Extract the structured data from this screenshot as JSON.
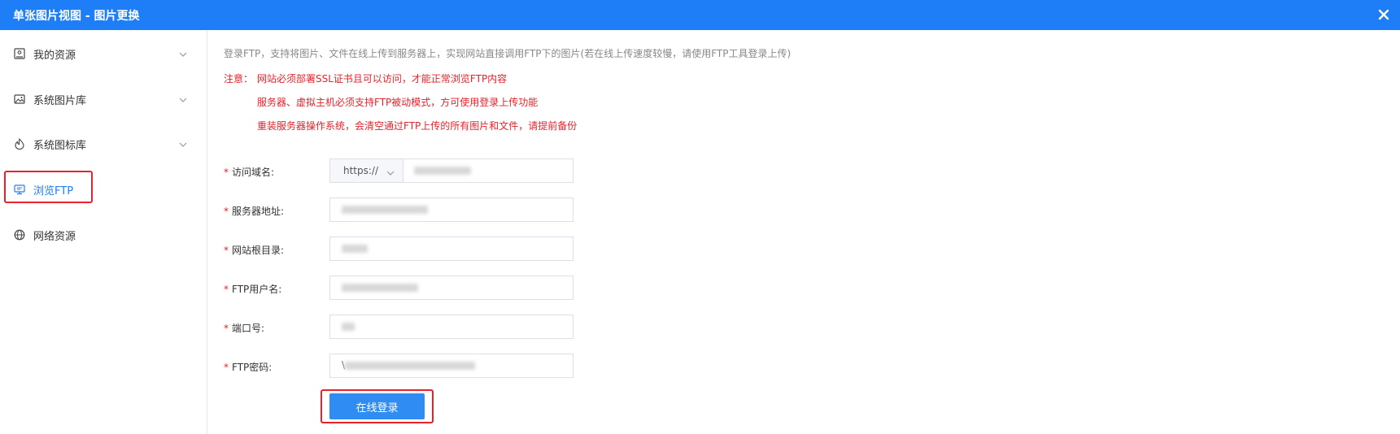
{
  "window": {
    "title": "单张图片视图 - 图片更换"
  },
  "sidebar": {
    "items": [
      {
        "label": "我的资源",
        "icon": "image-box-icon",
        "has_chevron": true
      },
      {
        "label": "系统图片库",
        "icon": "gallery-icon",
        "has_chevron": true
      },
      {
        "label": "系统图标库",
        "icon": "flame-icon",
        "has_chevron": true
      },
      {
        "label": "浏览FTP",
        "icon": "monitor-icon",
        "has_chevron": false,
        "active": true
      },
      {
        "label": "网络资源",
        "icon": "globe-icon",
        "has_chevron": false
      }
    ]
  },
  "main": {
    "intro": "登录FTP，支持将图片、文件在线上传到服务器上，实现网站直接调用FTP下的图片(若在线上传速度较慢，请使用FTP工具登录上传)",
    "notice_prefix": "注意：",
    "notices": [
      "网站必须部署SSL证书且可以访问，才能正常浏览FTP内容",
      "服务器、虚拟主机必须支持FTP被动模式，方可使用登录上传功能",
      "重装服务器操作系统，会清空通过FTP上传的所有图片和文件，请提前备份"
    ],
    "form": {
      "required_mark": "*",
      "domain_label": "访问域名:",
      "protocol_value": "https://",
      "server_label": "服务器地址:",
      "root_label": "网站根目录:",
      "user_label": "FTP用户名:",
      "port_label": "端口号:",
      "password_label": "FTP密码:",
      "password_prefix": "\\"
    },
    "login_button": "在线登录"
  },
  "colors": {
    "accent": "#1e7ef7",
    "danger": "#e8222a",
    "button": "#2f8cf2"
  }
}
